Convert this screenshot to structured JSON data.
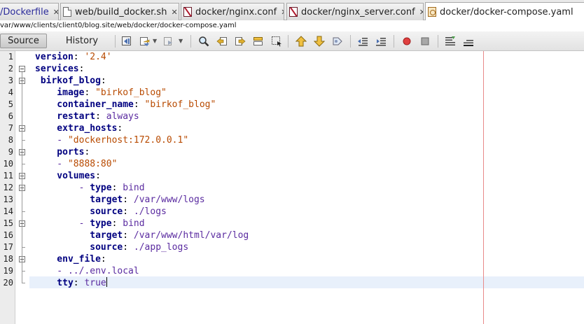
{
  "tabs": [
    {
      "label": "/Dockerfile",
      "close": "✕",
      "icon": "none"
    },
    {
      "label": "web/build_docker.sh",
      "close": "✕",
      "icon": "document-icon"
    },
    {
      "label": "docker/nginx.conf",
      "close": "✕",
      "icon": "config-file-icon"
    },
    {
      "label": "docker/nginx_server.conf",
      "close": "✕",
      "icon": "config-file-icon"
    },
    {
      "label": "docker/docker-compose.yaml",
      "icon": "yaml-file-icon",
      "active": true
    }
  ],
  "path": "var/www/clients/client0/blog.site/web/docker/docker-compose.yaml",
  "toolbar": {
    "source_label": "Source",
    "history_label": "History"
  },
  "editor": {
    "line_numbers": [
      "1",
      "2",
      "3",
      "4",
      "5",
      "6",
      "7",
      "8",
      "9",
      "10",
      "11",
      "12",
      "13",
      "14",
      "15",
      "16",
      "17",
      "18",
      "19",
      "20"
    ],
    "current_line": 20,
    "colors": {
      "key": "#000080",
      "string": "#b84a00",
      "value": "#5a2ba0",
      "margin_line": "#e88a8a",
      "current_line_bg": "#e8f0fb"
    },
    "lines": [
      [
        {
          "t": "version",
          "c": "k"
        },
        {
          "t": ": ",
          "c": "p"
        },
        {
          "t": "'2.4'",
          "c": "s"
        }
      ],
      [
        {
          "t": "services",
          "c": "k"
        },
        {
          "t": ":",
          "c": "p"
        }
      ],
      [
        {
          "t": " birkof_blog",
          "c": "k"
        },
        {
          "t": ":",
          "c": "p"
        }
      ],
      [
        {
          "t": "    image",
          "c": "k"
        },
        {
          "t": ": ",
          "c": "p"
        },
        {
          "t": "\"birkof_blog\"",
          "c": "s"
        }
      ],
      [
        {
          "t": "    container_name",
          "c": "k"
        },
        {
          "t": ": ",
          "c": "p"
        },
        {
          "t": "\"birkof_blog\"",
          "c": "s"
        }
      ],
      [
        {
          "t": "    restart",
          "c": "k"
        },
        {
          "t": ": ",
          "c": "p"
        },
        {
          "t": "always",
          "c": "v"
        }
      ],
      [
        {
          "t": "    extra_hosts",
          "c": "k"
        },
        {
          "t": ":",
          "c": "p"
        }
      ],
      [
        {
          "t": "    - ",
          "c": "d"
        },
        {
          "t": "\"dockerhost:172.0.0.1\"",
          "c": "s"
        }
      ],
      [
        {
          "t": "    ports",
          "c": "k"
        },
        {
          "t": ":",
          "c": "p"
        }
      ],
      [
        {
          "t": "    - ",
          "c": "d"
        },
        {
          "t": "\"8888:80\"",
          "c": "s"
        }
      ],
      [
        {
          "t": "    volumes",
          "c": "k"
        },
        {
          "t": ":",
          "c": "p"
        }
      ],
      [
        {
          "t": "        - ",
          "c": "d"
        },
        {
          "t": "type",
          "c": "k"
        },
        {
          "t": ": ",
          "c": "p"
        },
        {
          "t": "bind",
          "c": "v"
        }
      ],
      [
        {
          "t": "          target",
          "c": "k"
        },
        {
          "t": ": ",
          "c": "p"
        },
        {
          "t": "/var/www/logs",
          "c": "v"
        }
      ],
      [
        {
          "t": "          source",
          "c": "k"
        },
        {
          "t": ": ",
          "c": "p"
        },
        {
          "t": "./logs",
          "c": "v"
        }
      ],
      [
        {
          "t": "        - ",
          "c": "d"
        },
        {
          "t": "type",
          "c": "k"
        },
        {
          "t": ": ",
          "c": "p"
        },
        {
          "t": "bind",
          "c": "v"
        }
      ],
      [
        {
          "t": "          target",
          "c": "k"
        },
        {
          "t": ": ",
          "c": "p"
        },
        {
          "t": "/var/www/html/var/log",
          "c": "v"
        }
      ],
      [
        {
          "t": "          source",
          "c": "k"
        },
        {
          "t": ": ",
          "c": "p"
        },
        {
          "t": "./app_logs",
          "c": "v"
        }
      ],
      [
        {
          "t": "    env_file",
          "c": "k"
        },
        {
          "t": ":",
          "c": "p"
        }
      ],
      [
        {
          "t": "    - ",
          "c": "d"
        },
        {
          "t": "../.env.local",
          "c": "v"
        }
      ],
      [
        {
          "t": "    tty",
          "c": "k"
        },
        {
          "t": ": ",
          "c": "p"
        },
        {
          "t": "true",
          "c": "v"
        }
      ]
    ]
  }
}
